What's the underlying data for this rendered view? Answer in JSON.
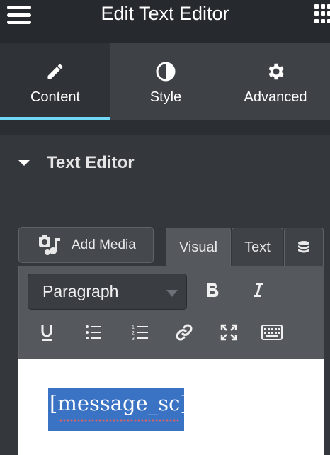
{
  "header": {
    "title": "Edit Text Editor",
    "menu_icon": "hamburger-icon",
    "apps_icon": "grid-icon"
  },
  "tabs": [
    {
      "label": "Content",
      "icon": "pencil-icon",
      "active": true
    },
    {
      "label": "Style",
      "icon": "half-circle-icon",
      "active": false
    },
    {
      "label": "Advanced",
      "icon": "gear-icon",
      "active": false
    }
  ],
  "section": {
    "title": "Text Editor",
    "icon": "caret-down-icon"
  },
  "editor": {
    "add_media_label": "Add Media",
    "mode_tabs": {
      "visual": "Visual",
      "text": "Text"
    },
    "format_select": "Paragraph",
    "toolbar_icons": [
      "bold-icon",
      "italic-icon",
      "underline-icon",
      "bullet-list-icon",
      "numbered-list-icon",
      "link-icon",
      "fullscreen-icon",
      "keyboard-icon"
    ],
    "content_text": "[message_sc]"
  },
  "colors": {
    "accent": "#71d7f7",
    "selection": "#3a72c4"
  }
}
